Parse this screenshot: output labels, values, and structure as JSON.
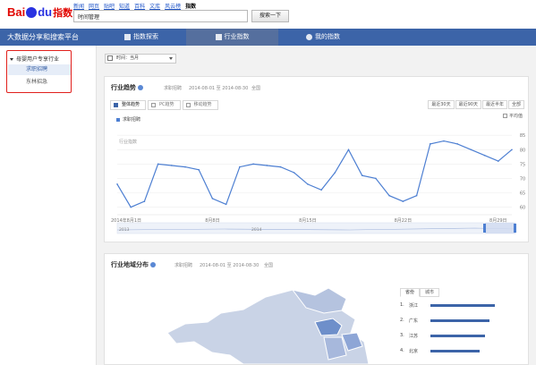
{
  "header": {
    "logo_bai": "Bai",
    "logo_du": "du",
    "logo_zhishu": "指数",
    "nav_links": [
      "新闻",
      "网页",
      "贴吧",
      "知道",
      "百科",
      "文库",
      "风云榜",
      "指数"
    ],
    "active_link": "指数",
    "search_value": "时间管理",
    "search_button": "搜索一下"
  },
  "navbar": {
    "platform_title": "大数据分享和搜索平台",
    "tabs": [
      {
        "label": "指数探索",
        "icon": "bar-chart-icon"
      },
      {
        "label": "行业指数",
        "icon": "industry-icon"
      },
      {
        "label": "我的指数",
        "icon": "user-icon"
      }
    ],
    "active_tab": "行业指数"
  },
  "sidebar": {
    "group": "母婴用户专享行业",
    "items": [
      "求职招聘",
      "东林招急"
    ],
    "active_item": "求职招聘"
  },
  "main": {
    "time_select": "时间：当月",
    "trend_card": {
      "title": "行业趋势",
      "meta_tag": "求职招聘",
      "meta_range": "2014-08-01 至 2014-08-30",
      "meta_scope": "全国",
      "subtabs": [
        "整体趋势",
        "PC趋势",
        "移动趋势"
      ],
      "active_subtab": "整体趋势",
      "range_buttons": [
        "最近30天",
        "最近90天",
        "最近半年",
        "全部"
      ],
      "avg_label": "平均值",
      "legend": "求职招聘",
      "y_axis_title": "行业指数",
      "brush_left": "2013",
      "brush_mid": "2014"
    },
    "region_card": {
      "title": "行业地域分布",
      "meta_tag": "求职招聘",
      "meta_range": "2014-08-01 至 2014-08-30",
      "meta_scope": "全国",
      "rank_tabs": [
        "省份",
        "城市"
      ],
      "active_rank_tab": "省份",
      "ranking": [
        {
          "rank": "1.",
          "name": "浙江",
          "level": 0.92
        },
        {
          "rank": "2.",
          "name": "广东",
          "level": 0.85
        },
        {
          "rank": "3.",
          "name": "江苏",
          "level": 0.78
        },
        {
          "rank": "4.",
          "name": "北京",
          "level": 0.7
        }
      ]
    }
  },
  "chart_data": {
    "type": "line",
    "title": "",
    "ylabel": "行业指数",
    "xlabel": "",
    "x_tick_labels": [
      "2014年8月1日",
      "8月8日",
      "8月15日",
      "8月22日",
      "8月29日"
    ],
    "y_tick_labels": [
      "85",
      "80",
      "75",
      "70",
      "65",
      "60"
    ],
    "ylim": [
      58,
      86
    ],
    "grid": true,
    "legend_position": "top-left",
    "series": [
      {
        "name": "求职招聘",
        "color": "#4d7fd2",
        "x": [
          "8-01",
          "8-02",
          "8-03",
          "8-04",
          "8-05",
          "8-06",
          "8-07",
          "8-08",
          "8-09",
          "8-10",
          "8-11",
          "8-12",
          "8-13",
          "8-14",
          "8-15",
          "8-16",
          "8-17",
          "8-18",
          "8-19",
          "8-20",
          "8-21",
          "8-22",
          "8-23",
          "8-24",
          "8-25",
          "8-26",
          "8-27",
          "8-28",
          "8-29",
          "8-30"
        ],
        "values": [
          68,
          60,
          62,
          75,
          74.5,
          74,
          73,
          63,
          61,
          74,
          75,
          74.5,
          74,
          72,
          68,
          66,
          72,
          80,
          71,
          70,
          64,
          62,
          64,
          82,
          83,
          82,
          80,
          78,
          76,
          80
        ]
      }
    ]
  }
}
